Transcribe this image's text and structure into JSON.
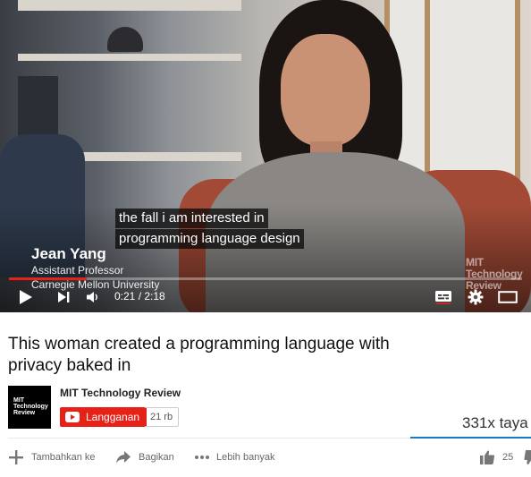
{
  "video": {
    "captions": [
      "the fall i am interested in",
      "programming language design"
    ],
    "lower_third": {
      "name": "Jean Yang",
      "role": "Assistant Professor",
      "org": "Carnegie Mellon University"
    },
    "watermark": [
      "MIT",
      "Technology",
      "Review"
    ],
    "time": "0:21 / 2:18",
    "progress": 0.152,
    "accent_color": "#e62117"
  },
  "info": {
    "title": "This woman created a programming language with privacy baked in",
    "channel": {
      "name": "MIT Technology Review",
      "avatar_text": [
        "MIT",
        "Technology",
        "Review"
      ],
      "subscribe_label": "Langganan",
      "subscriber_count": "21 rb"
    },
    "views": "331x taya",
    "actions": {
      "add_label": "Tambahkan ke",
      "share_label": "Bagikan",
      "more_label": "Lebih banyak",
      "like_count": "25"
    }
  }
}
